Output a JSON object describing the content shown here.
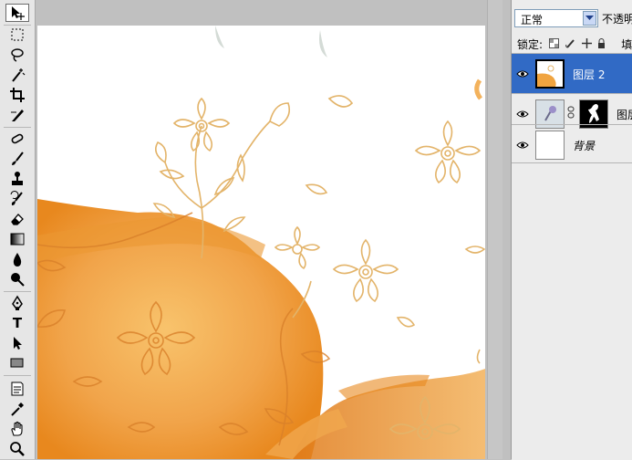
{
  "toolbar": {
    "tools": [
      {
        "name": "move-tool-icon",
        "active": true
      },
      {
        "name": "marquee-tool-icon"
      },
      {
        "name": "lasso-tool-icon"
      },
      {
        "name": "magic-wand-tool-icon"
      },
      {
        "name": "crop-tool-icon"
      },
      {
        "name": "slice-tool-icon"
      },
      {
        "name": "healing-brush-tool-icon"
      },
      {
        "name": "brush-tool-icon"
      },
      {
        "name": "clone-stamp-tool-icon"
      },
      {
        "name": "history-brush-tool-icon"
      },
      {
        "name": "eraser-tool-icon"
      },
      {
        "name": "gradient-tool-icon"
      },
      {
        "name": "blur-tool-icon"
      },
      {
        "name": "dodge-tool-icon"
      },
      {
        "name": "pen-tool-icon"
      },
      {
        "name": "type-tool-icon",
        "glyph": "T"
      },
      {
        "name": "path-selection-tool-icon"
      },
      {
        "name": "rectangle-tool-icon"
      },
      {
        "name": "notes-tool-icon"
      },
      {
        "name": "eyedropper-tool-icon"
      },
      {
        "name": "hand-tool-icon"
      },
      {
        "name": "zoom-tool-icon"
      }
    ]
  },
  "layers_panel": {
    "blend_mode": "正常",
    "opacity_label": "不透明",
    "lock_label": "锁定:",
    "fill_label": "填",
    "layers": [
      {
        "name": "图层 2",
        "selected": true,
        "visible": true
      },
      {
        "name": "图层",
        "selected": false,
        "visible": true,
        "has_mask": true
      },
      {
        "name": "背景",
        "selected": false,
        "visible": true
      }
    ]
  },
  "colors": {
    "selection": "#316ac5",
    "orange_dark": "#e8891e",
    "orange_light": "#f6c77a",
    "line_art": "#e3b46a"
  }
}
